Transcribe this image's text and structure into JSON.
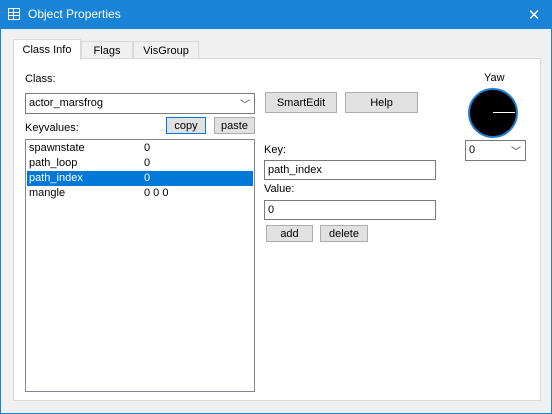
{
  "window": {
    "title": "Object Properties"
  },
  "tabs": [
    "Class Info",
    "Flags",
    "VisGroup"
  ],
  "class_section": {
    "class_label": "Class:",
    "class_value": "actor_marsfrog",
    "smartedit_label": "SmartEdit",
    "help_label": "Help"
  },
  "keyvalues": {
    "label": "Keyvalues:",
    "copy_label": "copy",
    "paste_label": "paste",
    "rows": [
      {
        "key": "spawnstate",
        "value": "0"
      },
      {
        "key": "path_loop",
        "value": "0"
      },
      {
        "key": "path_index",
        "value": "0"
      },
      {
        "key": "mangle",
        "value": "0 0 0"
      }
    ]
  },
  "editor": {
    "key_label": "Key:",
    "key_value": "path_index",
    "value_label": "Value:",
    "value_value": "0",
    "add_label": "add",
    "delete_label": "delete"
  },
  "yaw": {
    "label": "Yaw",
    "value": "0"
  },
  "colors": {
    "accent": "#0078d7",
    "titlebar": "#1883d7"
  }
}
